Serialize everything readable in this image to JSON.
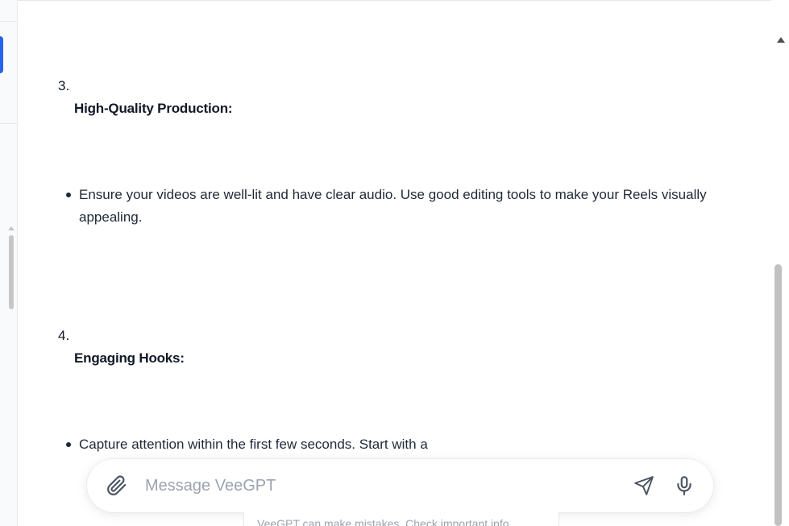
{
  "content": {
    "items": [
      {
        "number": "3.",
        "heading": "High-Quality Production:",
        "bullet": "Ensure your videos are well-lit and have clear audio. Use good editing tools to make your Reels visually appealing."
      },
      {
        "number": "4.",
        "heading": "Engaging Hooks:",
        "bullet": "Capture attention within the first few seconds. Start with a"
      }
    ]
  },
  "composer": {
    "placeholder": "Message VeeGPT",
    "value": "",
    "icons": {
      "attach": "paperclip-icon",
      "send": "send-icon",
      "mic": "microphone-icon"
    }
  },
  "footer": {
    "disclaimer": "VeeGPT can make mistakes. Check important info."
  },
  "colors": {
    "accent": "#2563eb",
    "text": "#1f2937",
    "muted": "#9ca3af"
  }
}
